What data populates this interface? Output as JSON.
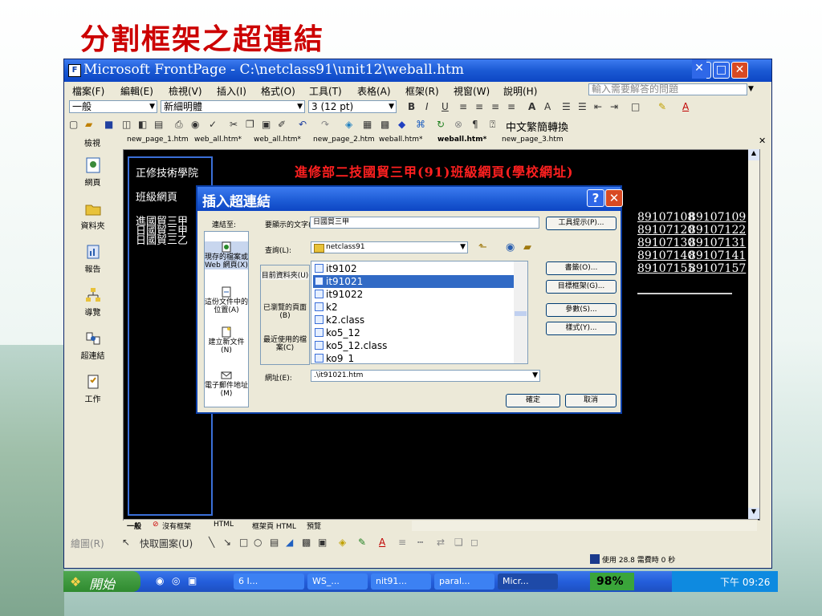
{
  "slide": {
    "title": "分割框架之超連結"
  },
  "window": {
    "title": "Microsoft FrontPage - C:\\netclass91\\unit12\\weball.htm",
    "controls": {
      "minimize": "_",
      "maximize": "□",
      "close": "✕"
    }
  },
  "menu": {
    "items": [
      "檔案(F)",
      "編輯(E)",
      "檢視(V)",
      "插入(I)",
      "格式(O)",
      "工具(T)",
      "表格(A)",
      "框架(R)",
      "視窗(W)",
      "說明(H)"
    ],
    "help_placeholder": "輸入需要解答的問題"
  },
  "format_toolbar": {
    "style": "一般",
    "font": "新細明體",
    "size": "3 (12 pt)",
    "bold": "B",
    "italic": "I",
    "underline": "U",
    "color_a": "A"
  },
  "standard_toolbar": {
    "convert_label": "中文繁簡轉換"
  },
  "views_label": "檢視",
  "tabs": [
    {
      "label": "new_page_1.htm",
      "active": false
    },
    {
      "label": "web_all.htm*",
      "active": false
    },
    {
      "label": "web_all.htm*",
      "active": false
    },
    {
      "label": "new_page_2.htm",
      "active": false
    },
    {
      "label": "weball.htm*",
      "active": false
    },
    {
      "label": "weball.htm*",
      "active": true
    },
    {
      "label": "new_page_3.htm",
      "active": false
    }
  ],
  "views": [
    "網頁",
    "資料夾",
    "報告",
    "導覽",
    "超連結",
    "工作"
  ],
  "editor": {
    "left_frame": {
      "lines": [
        "正修技術學院",
        "班級網頁",
        "進國貿三甲",
        "日國貿三甲",
        "日國貿三乙"
      ]
    },
    "banner": "進修部二技國貿三甲(91)班級網頁(學校網址)",
    "links": [
      "89107108",
      "89107109",
      "89107120",
      "89107122",
      "89107130",
      "89107131",
      "89107140",
      "89107141",
      "89107155",
      "89107157"
    ]
  },
  "view_tabs": [
    "一般",
    "沒有框架",
    "HTML",
    "框架頁 HTML",
    "預覽"
  ],
  "drawing_bar": {
    "draw_label": "繪圖(R)",
    "autoshape_label": "快取圖案(U)"
  },
  "status": {
    "text": "使用 28.8 需費時 0 秒"
  },
  "dialog": {
    "title": "插入超連結",
    "help": "?",
    "close": "✕",
    "link_to_label": "連結至:",
    "display_text_label": "要顯示的文字(T):",
    "display_text_value": "日國貿三甲",
    "screen_tip_button": "工具提示(P)...",
    "look_in_label": "查詢(L):",
    "look_in_value": "netclass91",
    "link_to_items": [
      "現存的檔案或 Web 網頁(X)",
      "這份文件中的位置(A)",
      "建立新文件(N)",
      "電子郵件地址(M)"
    ],
    "selector_items": [
      "目前資料夾(U)",
      "已瀏覽的頁面(B)",
      "最近使用的檔案(C)"
    ],
    "files": [
      {
        "name": "it9102",
        "selected": false
      },
      {
        "name": "it91021",
        "selected": true
      },
      {
        "name": "it91022",
        "selected": false
      },
      {
        "name": "k2",
        "selected": false
      },
      {
        "name": "k2.class",
        "selected": false
      },
      {
        "name": "ko5_12",
        "selected": false
      },
      {
        "name": "ko5_12.class",
        "selected": false
      },
      {
        "name": "ko9_1",
        "selected": false
      }
    ],
    "side_buttons": [
      "書籤(O)...",
      "目標框架(G)...",
      "參數(S)...",
      "樣式(Y)..."
    ],
    "address_label": "網址(E):",
    "address_value": ".\\it91021.htm",
    "ok": "確定",
    "cancel": "取消"
  },
  "taskbar": {
    "start": "開始",
    "items": [
      "6 I...",
      "WS_...",
      "nit91...",
      "paral...",
      "Micr..."
    ],
    "percent": "98%",
    "clock": "下午 09:26"
  },
  "colors": {
    "title_red": "#cc0000",
    "xp_blue": "#1b5ad4",
    "selection": "#316ac5"
  }
}
